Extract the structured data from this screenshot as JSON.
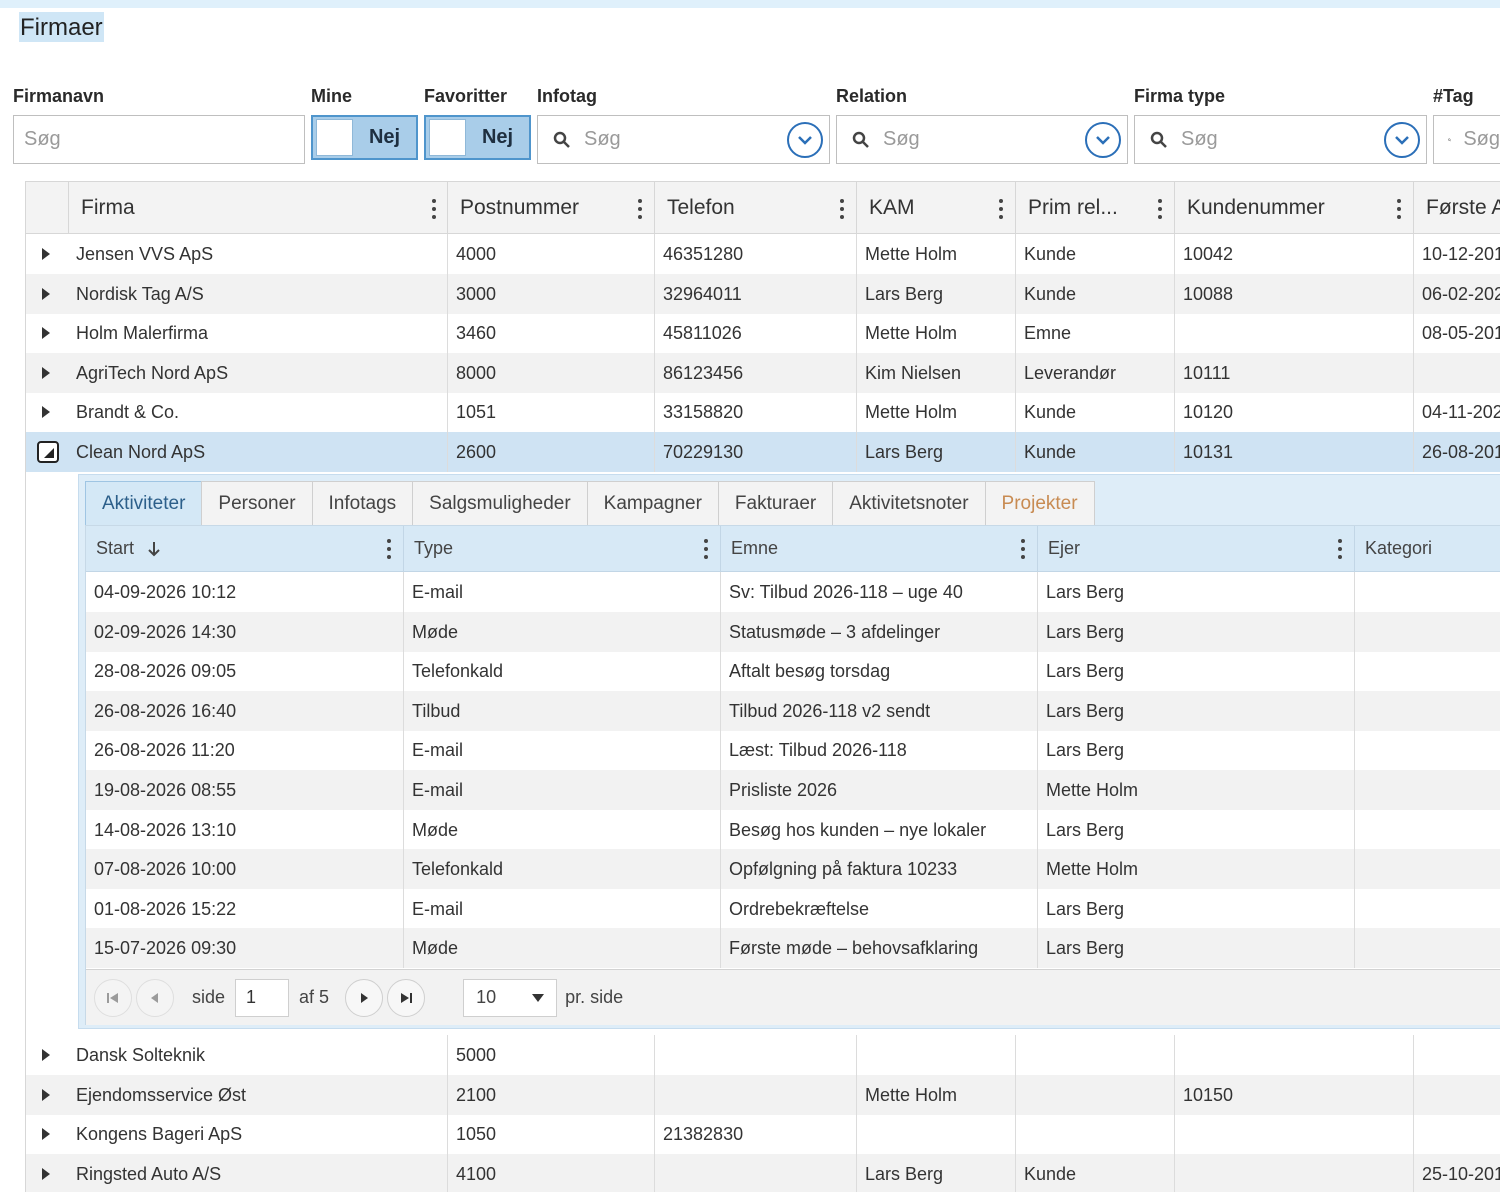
{
  "page": {
    "title": "Firmaer"
  },
  "filters": {
    "firmanavn": {
      "label": "Firmanavn",
      "placeholder": "Søg"
    },
    "mine": {
      "label": "Mine",
      "value": "Nej"
    },
    "favoritter": {
      "label": "Favoritter",
      "value": "Nej"
    },
    "infotag": {
      "label": "Infotag",
      "placeholder": "Søg"
    },
    "relation": {
      "label": "Relation",
      "placeholder": "Søg"
    },
    "firmatype": {
      "label": "Firma type",
      "placeholder": "Søg"
    },
    "tag": {
      "label": "#Tag",
      "placeholder": "Søg"
    }
  },
  "grid": {
    "columns": [
      "Firma",
      "Postnummer",
      "Telefon",
      "KAM",
      "Prim rel...",
      "Kundenummer",
      "Første A"
    ],
    "rows": [
      {
        "firma": "Jensen VVS ApS",
        "post": "4000",
        "tlf": "46351280",
        "kam": "Mette Holm",
        "prim": "Kunde",
        "kunde": "10042",
        "forste": "10-12-201"
      },
      {
        "firma": "Nordisk Tag A/S",
        "post": "3000",
        "tlf": "32964011",
        "kam": "Lars Berg",
        "prim": "Kunde",
        "kunde": "10088",
        "forste": "06-02-202"
      },
      {
        "firma": "Holm Malerfirma",
        "post": "3460",
        "tlf": "45811026",
        "kam": "Mette Holm",
        "prim": "Emne",
        "kunde": "",
        "forste": "08-05-201"
      },
      {
        "firma": "AgriTech Nord ApS",
        "post": "8000",
        "tlf": "86123456",
        "kam": "Kim Nielsen",
        "prim": "Leverandør",
        "kunde": "10111",
        "forste": ""
      },
      {
        "firma": "Brandt & Co.",
        "post": "1051",
        "tlf": "33158820",
        "kam": "Mette Holm",
        "prim": "Kunde",
        "kunde": "10120",
        "forste": "04-11-202"
      },
      {
        "firma": "Clean Nord ApS",
        "post": "2600",
        "tlf": "70229130",
        "kam": "Lars Berg",
        "prim": "Kunde",
        "kunde": "10131",
        "forste": "26-08-201"
      }
    ],
    "rows_after": [
      {
        "firma": "Dansk Solteknik",
        "post": "5000",
        "tlf": "",
        "kam": "",
        "prim": "",
        "kunde": "",
        "forste": ""
      },
      {
        "firma": "Ejendomsservice Øst",
        "post": "2100",
        "tlf": "",
        "kam": "Mette Holm",
        "prim": "",
        "kunde": "10150",
        "forste": ""
      },
      {
        "firma": "Kongens Bageri ApS",
        "post": "1050",
        "tlf": "21382830",
        "kam": "",
        "prim": "",
        "kunde": "",
        "forste": ""
      },
      {
        "firma": "Ringsted Auto A/S",
        "post": "4100",
        "tlf": "",
        "kam": "Lars Berg",
        "prim": "Kunde",
        "kunde": "",
        "forste": "25-10-201"
      }
    ]
  },
  "detail": {
    "tabs": [
      "Aktiviteter",
      "Personer",
      "Infotags",
      "Salgsmuligheder",
      "Kampagner",
      "Fakturaer",
      "Aktivitetsnoter",
      "Projekter"
    ],
    "columns": [
      "Start",
      "Type",
      "Emne",
      "Ejer",
      "Kategori"
    ],
    "rows": [
      {
        "start": "04-09-2026 10:12",
        "type": "E-mail",
        "emne": "Sv: Tilbud 2026-118 – uge 40",
        "ejer": "Lars Berg"
      },
      {
        "start": "02-09-2026 14:30",
        "type": "Møde",
        "emne": "Statusmøde – 3 afdelinger",
        "ejer": "Lars Berg"
      },
      {
        "start": "28-08-2026 09:05",
        "type": "Telefonkald",
        "emne": "Aftalt besøg torsdag",
        "ejer": "Lars Berg"
      },
      {
        "start": "26-08-2026 16:40",
        "type": "Tilbud",
        "emne": "Tilbud 2026-118 v2 sendt",
        "ejer": "Lars Berg"
      },
      {
        "start": "26-08-2026 11:20",
        "type": "E-mail",
        "emne": "Læst: Tilbud 2026-118",
        "ejer": "Lars Berg"
      },
      {
        "start": "19-08-2026 08:55",
        "type": "E-mail",
        "emne": "Prisliste 2026",
        "ejer": "Mette Holm"
      },
      {
        "start": "14-08-2026 13:10",
        "type": "Møde",
        "emne": "Besøg hos kunden – nye lokaler",
        "ejer": "Lars Berg"
      },
      {
        "start": "07-08-2026 10:00",
        "type": "Telefonkald",
        "emne": "Opfølgning på faktura 10233",
        "ejer": "Mette Holm"
      },
      {
        "start": "01-08-2026 15:22",
        "type": "E-mail",
        "emne": "Ordrebekræftelse",
        "ejer": "Lars Berg"
      },
      {
        "start": "15-07-2026 09:30",
        "type": "Møde",
        "emne": "Første møde – behovsafklaring",
        "ejer": "Lars Berg"
      }
    ],
    "pager": {
      "side_label": "side",
      "page": "1",
      "of_label": "af 5",
      "page_size": "10",
      "per_label": "pr. side"
    }
  }
}
